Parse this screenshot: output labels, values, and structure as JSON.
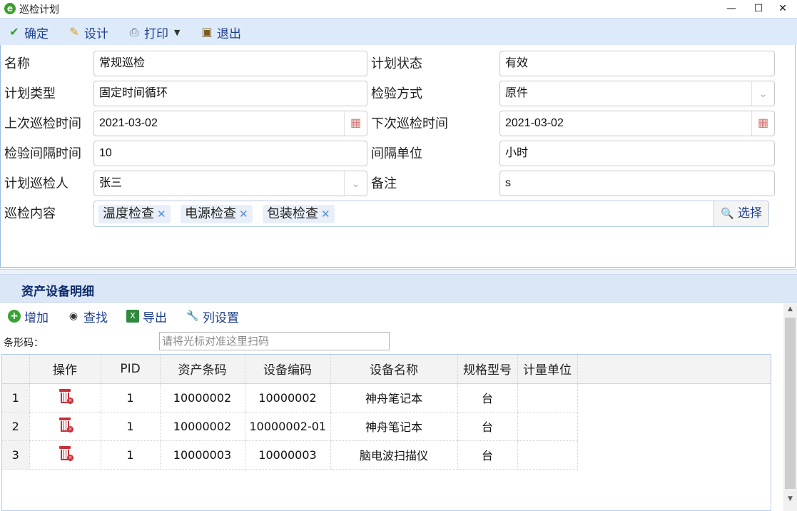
{
  "window": {
    "title": "巡检计划"
  },
  "toolbar": {
    "confirm": "确定",
    "design": "设计",
    "print": "打印",
    "exit": "退出"
  },
  "form": {
    "name_label": "名称",
    "name_value": "常规巡检",
    "status_label": "计划状态",
    "status_value": "有效",
    "type_label": "计划类型",
    "type_value": "固定时间循环",
    "method_label": "检验方式",
    "method_value": "原件",
    "last_label": "上次巡检时间",
    "last_value": "2021-03-02",
    "next_label": "下次巡检时间",
    "next_value": "2021-03-02",
    "interval_label": "检验间隔时间",
    "interval_value": "10",
    "unit_label": "间隔单位",
    "unit_value": "小时",
    "inspector_label": "计划巡检人",
    "inspector_value": "张三",
    "remark_label": "备注",
    "remark_value": "s",
    "content_label": "巡检内容",
    "content_tags": [
      "温度检查",
      "电源检查",
      "包装检查"
    ],
    "select_label": "选择"
  },
  "grid": {
    "section_title": "资产设备明细",
    "toolbar": {
      "add": "增加",
      "find": "查找",
      "export": "导出",
      "columns": "列设置"
    },
    "barcode_label": "条形码：",
    "barcode_placeholder": "请将光标对准这里扫码",
    "columns": [
      "操作",
      "PID",
      "资产条码",
      "设备编码",
      "设备名称",
      "规格型号",
      "计量单位"
    ],
    "rows": [
      {
        "no": "1",
        "pid": "1",
        "asset_code": "10000002",
        "device_code": "10000002",
        "device_name": "神舟笔记本",
        "spec": "台",
        "unit": ""
      },
      {
        "no": "2",
        "pid": "1",
        "asset_code": "10000002",
        "device_code": "10000002-01",
        "device_name": "神舟笔记本",
        "spec": "台",
        "unit": ""
      },
      {
        "no": "3",
        "pid": "1",
        "asset_code": "10000003",
        "device_code": "10000003",
        "device_name": "脑电波扫描仪",
        "spec": "台",
        "unit": ""
      }
    ]
  }
}
